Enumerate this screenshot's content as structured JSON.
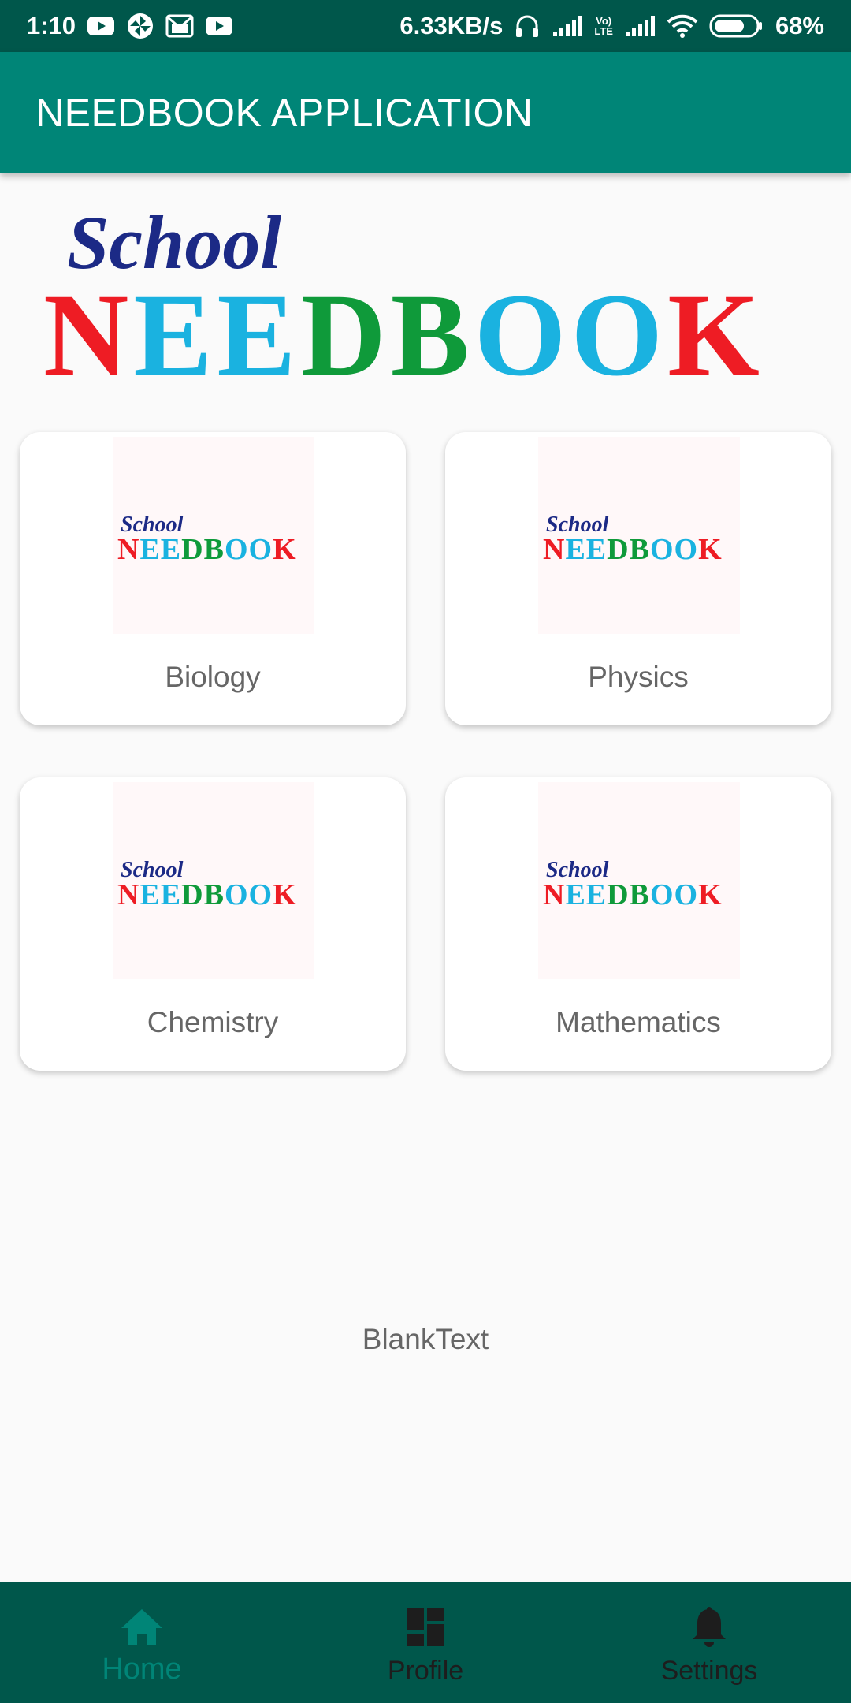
{
  "status_bar": {
    "time": "1:10",
    "net_speed": "6.33KB/s",
    "lte_badge_top": "Vo)",
    "lte_badge_bottom": "LTE",
    "battery": "68%",
    "left_icons": [
      "youtube-icon",
      "pinwheel-icon",
      "gmail-icon",
      "youtube-icon"
    ],
    "right_icons": [
      "headphones-icon",
      "signal-icon",
      "volte-icon",
      "signal-icon",
      "wifi-icon",
      "battery-icon"
    ]
  },
  "app_bar": {
    "title": "NEEDBOOK APPLICATION"
  },
  "banner": {
    "line1": "School",
    "line2": "NEEDBOOK"
  },
  "cards": [
    {
      "label": "Biology",
      "logo_line1": "School",
      "logo_line2": "NEEDBOOK"
    },
    {
      "label": "Physics",
      "logo_line1": "School",
      "logo_line2": "NEEDBOOK"
    },
    {
      "label": "Chemistry",
      "logo_line1": "School",
      "logo_line2": "NEEDBOOK"
    },
    {
      "label": "Mathematics",
      "logo_line1": "School",
      "logo_line2": "NEEDBOOK"
    }
  ],
  "blank_text": "BlankText",
  "bottom_nav": [
    {
      "label": "Home",
      "icon": "home-icon",
      "selected": true
    },
    {
      "label": "Profile",
      "icon": "dashboard-icon",
      "selected": false
    },
    {
      "label": "Settings",
      "icon": "bell-icon",
      "selected": false
    }
  ],
  "colors": {
    "status_bar": "#00574b",
    "app_bar": "#008577",
    "accent": "#008577",
    "bottom_nav": "#00574b",
    "logo_red": "#ee1c24",
    "logo_cyan": "#1ab2e0",
    "logo_green": "#0f9a3a",
    "logo_navy": "#1c2a86"
  }
}
